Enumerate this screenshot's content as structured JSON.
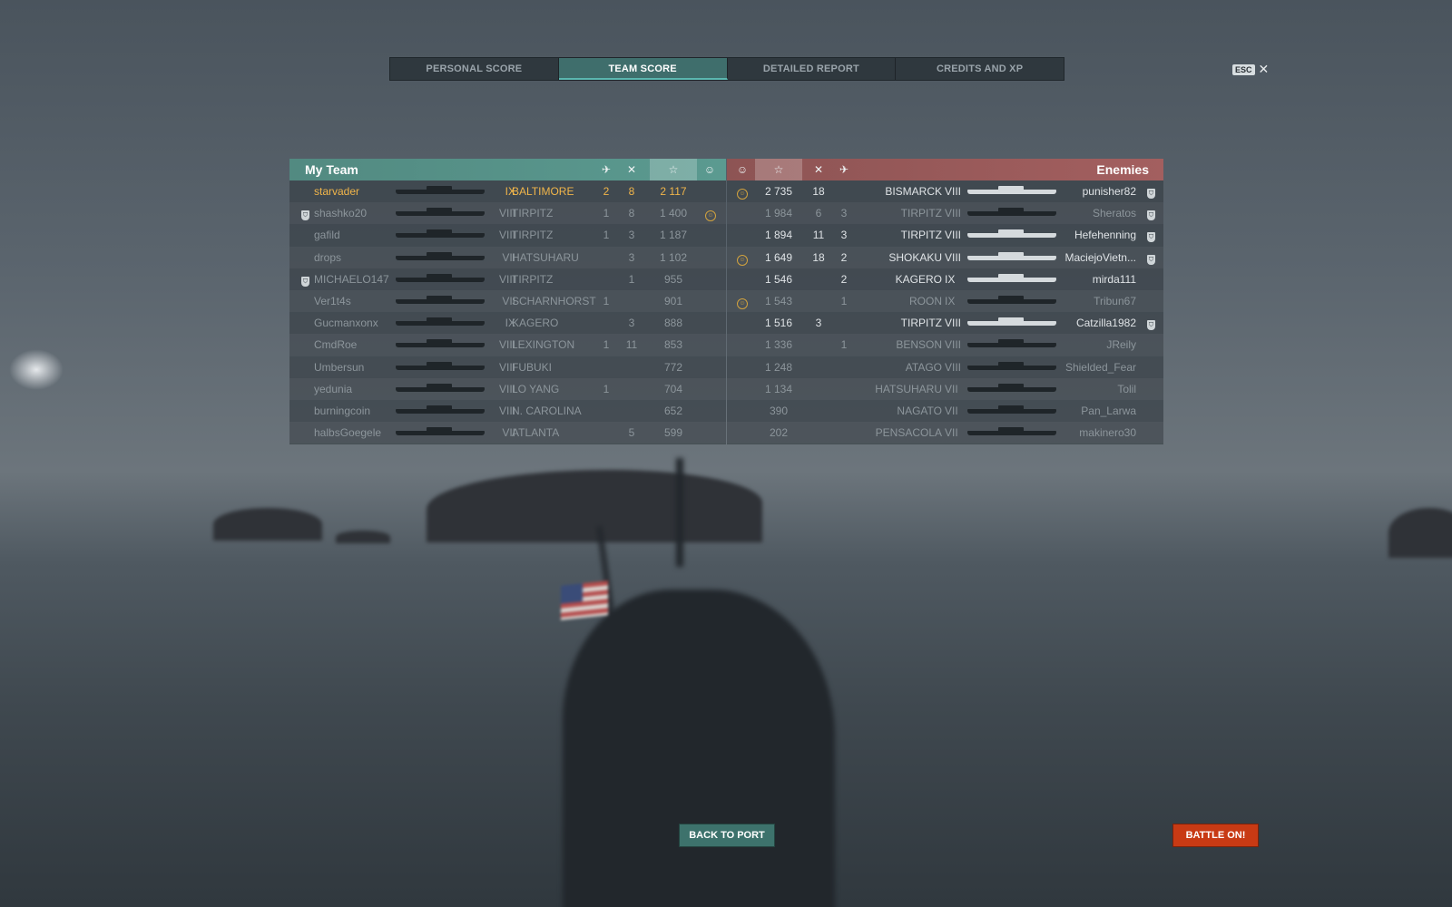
{
  "tabs": [
    {
      "label": "PERSONAL SCORE",
      "active": false
    },
    {
      "label": "TEAM SCORE",
      "active": true
    },
    {
      "label": "DETAILED REPORT",
      "active": false
    },
    {
      "label": "CREDITS AND XP",
      "active": false
    }
  ],
  "close": {
    "key": "ESC",
    "icon": "close-icon",
    "glyph": "✕"
  },
  "my_team": {
    "title": "My Team",
    "column_icons": [
      "planes-destroyed-icon",
      "ships-destroyed-icon",
      "experience-star-icon",
      "achievement-icon"
    ],
    "players": [
      {
        "name": "starvader",
        "tier": "IX",
        "ship": "BALTIMORE",
        "planes": "2",
        "kills": "8",
        "score": "2 117",
        "medal": false,
        "badge": false,
        "style": "self"
      },
      {
        "name": "shashko20",
        "tier": "VIII",
        "ship": "TIRPITZ",
        "planes": "1",
        "kills": "8",
        "score": "1 400",
        "medal": true,
        "badge": true,
        "style": "dim"
      },
      {
        "name": "gafild",
        "tier": "VIII",
        "ship": "TIRPITZ",
        "planes": "1",
        "kills": "3",
        "score": "1 187",
        "medal": false,
        "badge": false,
        "style": "dim"
      },
      {
        "name": "drops",
        "tier": "VII",
        "ship": "HATSUHARU",
        "planes": "",
        "kills": "3",
        "score": "1 102",
        "medal": false,
        "badge": false,
        "style": "dim"
      },
      {
        "name": "MICHAELO147",
        "tier": "VIII",
        "ship": "TIRPITZ",
        "planes": "",
        "kills": "1",
        "score": "955",
        "medal": false,
        "badge": true,
        "style": "dim"
      },
      {
        "name": "Ver1t4s",
        "tier": "VII",
        "ship": "SCHARNHORST",
        "planes": "1",
        "kills": "",
        "score": "901",
        "medal": false,
        "badge": false,
        "style": "dim"
      },
      {
        "name": "Gucmanxonx",
        "tier": "IX",
        "ship": "KAGERO",
        "planes": "",
        "kills": "3",
        "score": "888",
        "medal": false,
        "badge": false,
        "style": "dim"
      },
      {
        "name": "CmdRoe",
        "tier": "VIII",
        "ship": "LEXINGTON",
        "planes": "1",
        "kills": "11",
        "score": "853",
        "medal": false,
        "badge": false,
        "style": "dim"
      },
      {
        "name": "Umbersun",
        "tier": "VIII",
        "ship": "FUBUKI",
        "planes": "",
        "kills": "",
        "score": "772",
        "medal": false,
        "badge": false,
        "style": "dim"
      },
      {
        "name": "yedunia",
        "tier": "VIII",
        "ship": "LO YANG",
        "planes": "1",
        "kills": "",
        "score": "704",
        "medal": false,
        "badge": false,
        "style": "dim"
      },
      {
        "name": "burningcoin",
        "tier": "VIII",
        "ship": "N. CAROLINA",
        "planes": "",
        "kills": "",
        "score": "652",
        "medal": false,
        "badge": false,
        "style": "dim"
      },
      {
        "name": "halbsGoegele",
        "tier": "VII",
        "ship": "ATLANTA",
        "planes": "",
        "kills": "5",
        "score": "599",
        "medal": false,
        "badge": false,
        "style": "dim"
      }
    ]
  },
  "enemies": {
    "title": "Enemies",
    "column_icons": [
      "achievement-icon",
      "experience-star-icon",
      "ships-destroyed-icon",
      "planes-destroyed-icon"
    ],
    "players": [
      {
        "name": "punisher82",
        "tier": "VIII",
        "ship": "BISMARCK",
        "planes": "",
        "kills": "18",
        "score": "2 735",
        "medal": true,
        "badge": true,
        "style": "bright"
      },
      {
        "name": "Sheratos",
        "tier": "VIII",
        "ship": "TIRPITZ",
        "planes": "3",
        "kills": "6",
        "score": "1 984",
        "medal": false,
        "badge": true,
        "style": "dim"
      },
      {
        "name": "Hefehenning",
        "tier": "VIII",
        "ship": "TIRPITZ",
        "planes": "3",
        "kills": "11",
        "score": "1 894",
        "medal": false,
        "badge": true,
        "style": "bright"
      },
      {
        "name": "MaciejoVietn...",
        "tier": "VIII",
        "ship": "SHOKAKU",
        "planes": "2",
        "kills": "18",
        "score": "1 649",
        "medal": true,
        "badge": true,
        "style": "bright"
      },
      {
        "name": "mirda111",
        "tier": "IX",
        "ship": "KAGERO",
        "planes": "2",
        "kills": "",
        "score": "1 546",
        "medal": false,
        "badge": false,
        "style": "bright"
      },
      {
        "name": "Tribun67",
        "tier": "IX",
        "ship": "ROON",
        "planes": "1",
        "kills": "",
        "score": "1 543",
        "medal": true,
        "badge": false,
        "style": "dim"
      },
      {
        "name": "Catzilla1982",
        "tier": "VIII",
        "ship": "TIRPITZ",
        "planes": "",
        "kills": "3",
        "score": "1 516",
        "medal": false,
        "badge": true,
        "style": "bright"
      },
      {
        "name": "JReily",
        "tier": "VIII",
        "ship": "BENSON",
        "planes": "1",
        "kills": "",
        "score": "1 336",
        "medal": false,
        "badge": false,
        "style": "dim"
      },
      {
        "name": "Shielded_Fear",
        "tier": "VIII",
        "ship": "ATAGO",
        "planes": "",
        "kills": "",
        "score": "1 248",
        "medal": false,
        "badge": false,
        "style": "dim"
      },
      {
        "name": "Tolil",
        "tier": "VII",
        "ship": "HATSUHARU",
        "planes": "",
        "kills": "",
        "score": "1 134",
        "medal": false,
        "badge": false,
        "style": "dim"
      },
      {
        "name": "Pan_Larwa",
        "tier": "VII",
        "ship": "NAGATO",
        "planes": "",
        "kills": "",
        "score": "390",
        "medal": false,
        "badge": false,
        "style": "dim"
      },
      {
        "name": "makinero30",
        "tier": "VII",
        "ship": "PENSACOLA",
        "planes": "",
        "kills": "",
        "score": "202",
        "medal": false,
        "badge": false,
        "style": "dim"
      }
    ]
  },
  "buttons": {
    "back": "BACK TO PORT",
    "battle": "BATTLE ON!"
  },
  "colors": {
    "accent_team": "#5b9a90",
    "accent_enemy": "#a35f5f",
    "self": "#f0b54a",
    "battle_button": "#c83a14",
    "back_button": "#3d726c"
  }
}
